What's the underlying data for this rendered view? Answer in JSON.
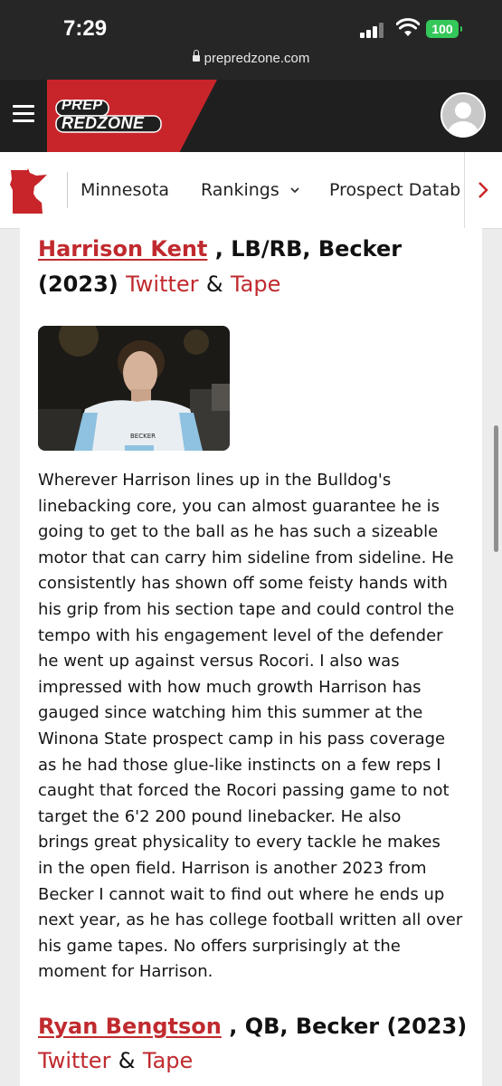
{
  "status_bar": {
    "time": "7:29",
    "battery": "100",
    "url": "prepredzone.com"
  },
  "header": {
    "logo_line1": "PREP",
    "logo_line2": "REDZONE"
  },
  "nav": {
    "items": [
      "Minnesota",
      "Rankings",
      "Prospect Datab"
    ]
  },
  "article": {
    "player1": {
      "name": "Harrison Kent",
      "details_line1": " , LB/RB, Becker",
      "year": "(2023)",
      "twitter": "Twitter",
      "amp": "&",
      "tape": "Tape",
      "photo_jersey_text": "BECKER",
      "paragraph_lines": [
        "Wherever Harrison lines up in the Bulldog's",
        "linebacking core, you can almost guarantee he is",
        "going to get to the ball as he has such a sizeable",
        "motor that can carry him sideline from sideline. He",
        "consistently has shown off some feisty hands with",
        "his grip from his section tape and could control the",
        "tempo with his engagement level of the defender",
        "he went up against versus Rocori. I also was",
        "impressed with how much growth Harrison has",
        "gauged since watching him this summer at the",
        "Winona State prospect camp in his pass coverage",
        "as he had those glue-like instincts on a few reps I",
        "caught that forced the Rocori passing game to not",
        "target the 6'2 200 pound linebacker. He also",
        "brings great physicality to every tackle he makes",
        "in the open field. Harrison is another 2023 from",
        "Becker I cannot wait to find out where he ends up",
        "next year, as he has college football written all over",
        "his game tapes. No offers surprisingly at the",
        "moment for Harrison."
      ]
    },
    "player2": {
      "name": "Ryan Bengtson",
      "details": " , QB, Becker (2023)",
      "twitter": "Twitter",
      "amp": "&",
      "tape": "Tape"
    }
  }
}
